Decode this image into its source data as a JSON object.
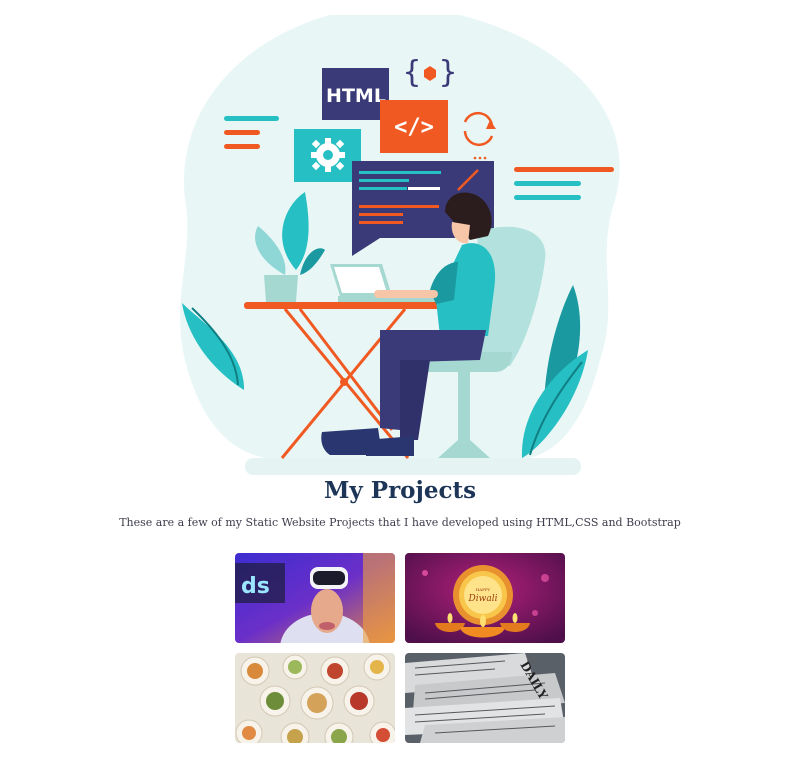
{
  "section": {
    "title": "My Projects",
    "subtitle": "These are a few of my Static Website Projects that I have developed using HTML,CSS and Bootstrap"
  },
  "hero": {
    "badge_html": "HTML",
    "code_icon": "</>",
    "braces_icon": "{ }",
    "icons": [
      "gear-icon",
      "code-icon",
      "braces-icon",
      "refresh-icon"
    ]
  },
  "projects": [
    {
      "name": "vr-gaming-project",
      "thumbnail": "person-with-vr-headset"
    },
    {
      "name": "diwali-project",
      "thumbnail": "happy-diwali-lamps",
      "thumbnail_text": "Happy Diwali"
    },
    {
      "name": "food-project",
      "thumbnail": "table-of-food-plates"
    },
    {
      "name": "news-project",
      "thumbnail": "stack-of-newspapers"
    }
  ],
  "colors": {
    "teal": "#26bfc3",
    "orange": "#f05a22",
    "navy": "#3a3a78",
    "title": "#1d3557",
    "blob": "#e8f7f6"
  }
}
